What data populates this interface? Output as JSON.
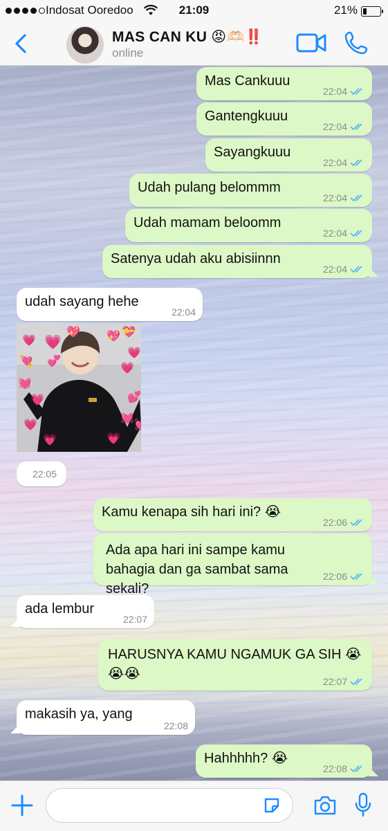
{
  "status_bar": {
    "carrier": "Indosat Ooredoo",
    "time": "21:09",
    "battery_percent": "21%",
    "battery_level": 0.21,
    "signal_bars_filled": 4,
    "signal_bars_total": 5
  },
  "header": {
    "back_icon": "chevron-left-icon",
    "contact_name": "MAS CAN KU 😡🫶🏻‼️",
    "contact_status": "online",
    "video_icon": "video-camera-icon",
    "call_icon": "phone-icon"
  },
  "messages": [
    {
      "dir": "out",
      "text": "Mas Cankuuu",
      "time": "22:04",
      "read": true
    },
    {
      "dir": "out",
      "text": "Gantengkuuu",
      "time": "22:04",
      "read": true
    },
    {
      "dir": "out",
      "text": "Sayangkuuu",
      "time": "22:04",
      "read": true
    },
    {
      "dir": "out",
      "text": "Udah pulang belommm",
      "time": "22:04",
      "read": true
    },
    {
      "dir": "out",
      "text": "Udah mamam beloomm",
      "time": "22:04",
      "read": true
    },
    {
      "dir": "out",
      "text": "Satenya udah aku abisiinnn",
      "time": "22:04",
      "read": true
    },
    {
      "dir": "in",
      "text": "udah sayang hehe",
      "time": "22:04"
    },
    {
      "dir": "in",
      "type": "image",
      "time": "22:05"
    },
    {
      "dir": "out",
      "text": "Kamu kenapa sih hari ini? 😭",
      "time": "22:06",
      "read": true
    },
    {
      "dir": "out",
      "text": "Ada apa hari ini sampe kamu bahagia dan ga sambat sama sekali?",
      "time": "22:06",
      "read": true
    },
    {
      "dir": "in",
      "text": "ada lembur",
      "time": "22:07"
    },
    {
      "dir": "out",
      "text": "HARUSNYA KAMU NGAMUK GA SIH 😭😭😭",
      "time": "22:07",
      "read": true
    },
    {
      "dir": "in",
      "text": "makasih ya, yang",
      "time": "22:08"
    },
    {
      "dir": "out",
      "text": "Hahhhhh? 😭",
      "time": "22:08",
      "read": true
    }
  ],
  "input_bar": {
    "plus_icon": "plus-icon",
    "placeholder": "",
    "sticker_icon": "sticker-icon",
    "camera_icon": "camera-icon",
    "mic_icon": "microphone-icon"
  },
  "colors": {
    "accent": "#1a8cff",
    "outgoing_bubble": "#dcf8c6",
    "incoming_bubble": "#ffffff",
    "read_ticks": "#4fb3f6"
  }
}
